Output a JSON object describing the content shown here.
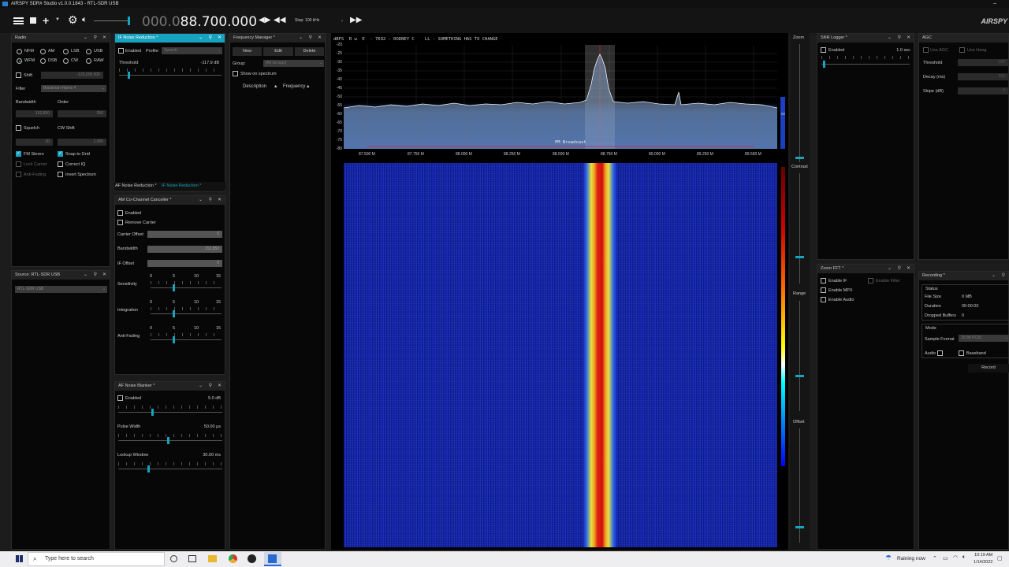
{
  "app": {
    "title": "AIRSPY SDR# Studio v1.0.0.1843 - RTL-SDR USB",
    "brand": "AIRSPY"
  },
  "toolbar": {
    "freq_dim": "000.0",
    "freq_main": "88.700.000",
    "step": "Step: 100 kHz"
  },
  "radio": {
    "title": "Radio",
    "modes": [
      "NFM",
      "AM",
      "LSB",
      "USB",
      "WFM",
      "DSB",
      "CW",
      "RAW"
    ],
    "selected": "WFM",
    "shift_label": "Shift",
    "shift_value": "-125,000,000",
    "filter_label": "Filter",
    "filter_value": "Blackman-Harris 4",
    "bandwidth_label": "Bandwidth",
    "order_label": "Order",
    "bandwidth_value": "152,850",
    "order_value": "250",
    "squelch_label": "Squelch",
    "cwshift_label": "CW Shift",
    "squelch_value": "20",
    "cwshift_value": "1,000",
    "fm_stereo": "FM Stereo",
    "snap_grid": "Snap to Grid",
    "lock_carrier": "Lock Carrier",
    "correct_iq": "Correct IQ",
    "anti_fading": "Anti-Fading",
    "invert_spectrum": "Invert Spectrum"
  },
  "source": {
    "title": "Source: RTL-SDR USB",
    "device": "RTL-SDR USB"
  },
  "ifnr": {
    "title": "IF Noise Reduction *",
    "enabled": "Enabled",
    "profile_label": "Profile:",
    "profile": "Speech",
    "threshold": "Threshold",
    "threshold_value": "-117.9 dB"
  },
  "nrtabs": {
    "tab1": "AF Noise Reduction *",
    "tab2": "IF Noise Reduction *"
  },
  "amcc": {
    "title": "AM Co-Channel Canceller *",
    "enabled": "Enabled",
    "remove_carrier": "Remove Carrier",
    "carrier_offset": "Carrier Offset",
    "carrier_offset_value": "0",
    "bandwidth": "Bandwidth",
    "bandwidth_value": "152,850",
    "if_offset": "IF Offset",
    "if_offset_value": "0",
    "sensitivity": "Sensitivity",
    "integration": "Integration",
    "anti_fading": "Anti-Fading",
    "scale": [
      "0",
      "5",
      "10",
      "15"
    ]
  },
  "afnb": {
    "title": "AF Noise Blanker *",
    "enabled": "Enabled",
    "enabled_value": "5.0 dB",
    "pulse_width": "Pulse Width",
    "pulse_width_value": "50.00 µs",
    "lookup_window": "Lookup Window",
    "lookup_window_value": "30.00 ms"
  },
  "freqmgr": {
    "title": "Frequency Manager *",
    "new": "New",
    "edit": "Edit",
    "delete": "Delete",
    "group_label": "Group:",
    "group": "[All Groups]",
    "show_on_spectrum": "Show on spectrum",
    "col_description": "Description",
    "col_frequency": "Frequency"
  },
  "spectrum": {
    "header": "dBFS  R w  E  - 7692 - RODNEY C    LL - SOMETHING HAS TO CHANGE",
    "ylabels": [
      "-20",
      "-25",
      "-30",
      "-35",
      "-40",
      "-45",
      "-50",
      "-55",
      "-60",
      "-65",
      "-70",
      "-75",
      "-80"
    ],
    "xlabels": [
      "87.500 M",
      "87.750 M",
      "88.000 M",
      "88.250 M",
      "88.500 M",
      "88.750 M",
      "89.000 M",
      "89.250 M",
      "89.500 M"
    ],
    "band": "FM Broadcast",
    "right_value": "50"
  },
  "zoomstrip": {
    "zoom": "Zoom",
    "contrast": "Contrast",
    "range": "Range",
    "offset": "Offset"
  },
  "snr": {
    "title": "SNR Logger *",
    "enabled": "Enabled",
    "value": "1.0 sec"
  },
  "agc": {
    "title": "AGC",
    "use_agc": "Use AGC",
    "use_hang": "Use Hang",
    "threshold": "Threshold",
    "threshold_value": "-100",
    "decay": "Decay (ms)",
    "decay_value": "500",
    "slope": "Slope (dB)",
    "slope_value": "0"
  },
  "zoomfft": {
    "title": "Zoom FFT *",
    "enable_if": "Enable IF",
    "enable_filter": "Enable Filter",
    "enable_mpx": "Enable MPX",
    "enable_audio": "Enable Audio"
  },
  "recording": {
    "title": "Recording *",
    "status": "Status",
    "file_size_label": "File Size",
    "file_size": "0 MB",
    "duration_label": "Duration",
    "duration": "00:00:00",
    "dropped_label": "Dropped Buffers",
    "dropped": "0",
    "mode": "Mode",
    "sample_format_label": "Sample Format",
    "sample_format": "16 Bit PCM",
    "audio": "Audio",
    "baseband": "Baseband",
    "record": "Record"
  },
  "taskbar": {
    "search": "Type here to search",
    "weather": "Raining now",
    "time": "10:19 AM",
    "date": "1/14/2022"
  }
}
